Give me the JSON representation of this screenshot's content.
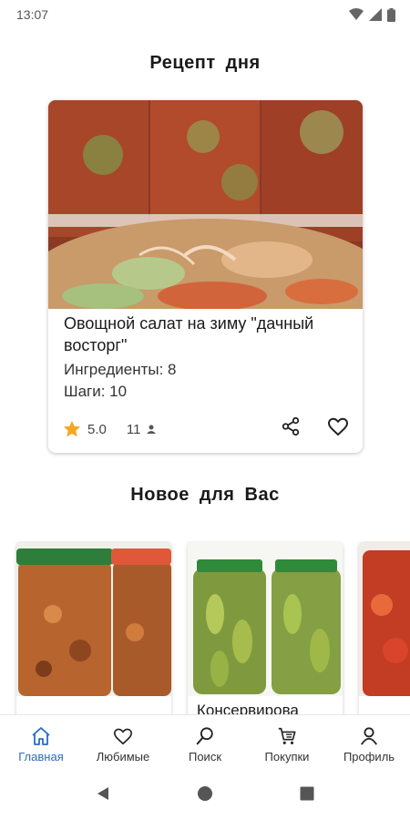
{
  "status_bar": {
    "time": "13:07"
  },
  "recipe_of_day": {
    "section_title": "Рецепт  дня",
    "title": "Овощной салат на зиму \"дачный восторг\"",
    "ingredients": "Ингредиенты: 8",
    "steps": "Шаги: 10",
    "rating": "5.0",
    "reviews": "11"
  },
  "new_for_you": {
    "section_title": "Новое  для  Вас",
    "items": [
      {
        "title": ""
      },
      {
        "title": "Консервирова"
      },
      {
        "title": ""
      }
    ]
  },
  "bottom_nav": {
    "items": [
      {
        "label": "Главная",
        "icon": "home-icon",
        "active": true
      },
      {
        "label": "Любимые",
        "icon": "heart-icon"
      },
      {
        "label": "Поиск",
        "icon": "search-icon"
      },
      {
        "label": "Покупки",
        "icon": "cart-icon"
      },
      {
        "label": "Профиль",
        "icon": "profile-icon"
      }
    ]
  },
  "colors": {
    "accent": "#2b6cc4",
    "star": "#f5a623"
  }
}
